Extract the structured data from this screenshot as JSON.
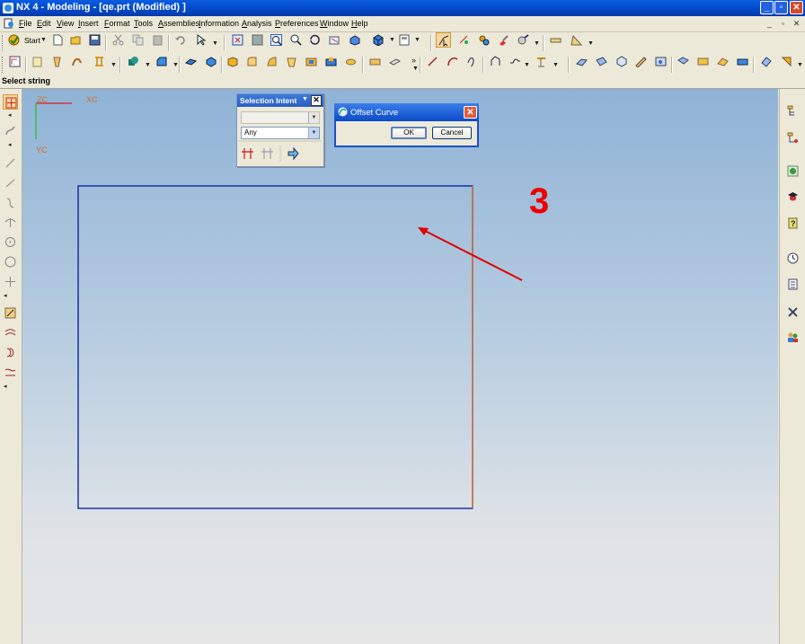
{
  "window": {
    "title": "NX 4 - Modeling - [qe.prt (Modified) ]",
    "min": "_",
    "max": "▫",
    "close": "✕"
  },
  "menu": {
    "items": [
      "File",
      "Edit",
      "View",
      "Insert",
      "Format",
      "Tools",
      "Assemblies",
      "Information",
      "Analysis",
      "Preferences",
      "Window",
      "Help"
    ],
    "mdi": {
      "min": "_",
      "restore": "▫",
      "close": "✕"
    }
  },
  "toolbar": {
    "start_label": "Start",
    "more": "»"
  },
  "status": {
    "prompt": "Select string"
  },
  "axes": {
    "zc": "ZC",
    "xc": "XC",
    "yc": "YC"
  },
  "selection_intent": {
    "title": "Selection Intent",
    "close": "✕",
    "combo1_value": "",
    "combo2_value": "Any"
  },
  "offset_curve": {
    "title": "Offset Curve",
    "close": "✕",
    "ok_label": "OK",
    "cancel_label": "Cancel"
  },
  "annotation": {
    "step": "3",
    "color": "#e00000"
  },
  "colors": {
    "curve_blue": "#001a9c",
    "curve_orange": "#e0661e",
    "xc_axis": "#d62020",
    "yc_axis": "#20c020"
  }
}
